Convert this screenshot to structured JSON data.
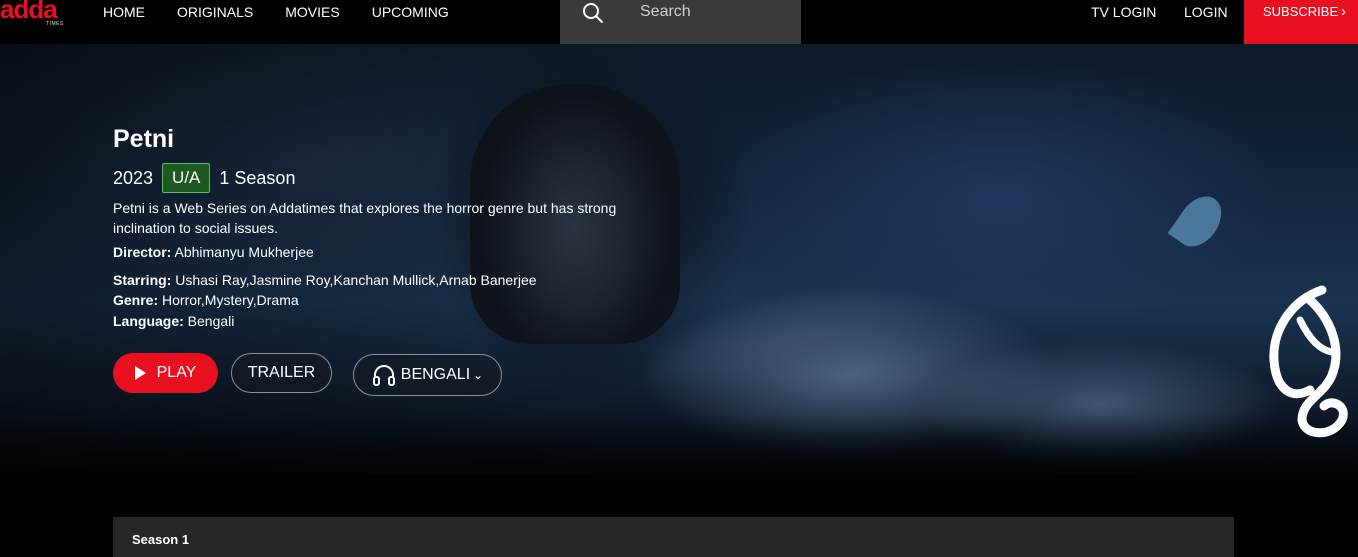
{
  "brand": {
    "logo_text": "adda",
    "logo_sub": "TIMES",
    "accent": "#e8101e"
  },
  "nav": {
    "items": [
      "HOME",
      "ORIGINALS",
      "MOVIES",
      "UPCOMING"
    ]
  },
  "search": {
    "placeholder": "Search",
    "value": ""
  },
  "right_nav": {
    "tv_login": "TV LOGIN",
    "login": "LOGIN",
    "subscribe": "SUBSCRIBE",
    "subscribe_icon": "chevron-right-icon"
  },
  "show": {
    "title": "Petni",
    "year": "2023",
    "rating": "U/A",
    "seasons": "1 Season",
    "description": "Petni is a Web Series on Addatimes that explores the horror genre but has strong inclination to social issues.",
    "director_label": "Director:",
    "director": "Abhimanyu Mukherjee",
    "starring_label": "Starring:",
    "starring": "Ushasi Ray,Jasmine Roy,Kanchan Mullick,Arnab Banerjee",
    "genre_label": "Genre:",
    "genre": "Horror,Mystery,Drama",
    "language_label": "Language:",
    "language": "Bengali"
  },
  "actions": {
    "play": "PLAY",
    "trailer": "TRAILER",
    "audio": "BENGALI"
  },
  "season_bar": {
    "label": "Season 1"
  }
}
